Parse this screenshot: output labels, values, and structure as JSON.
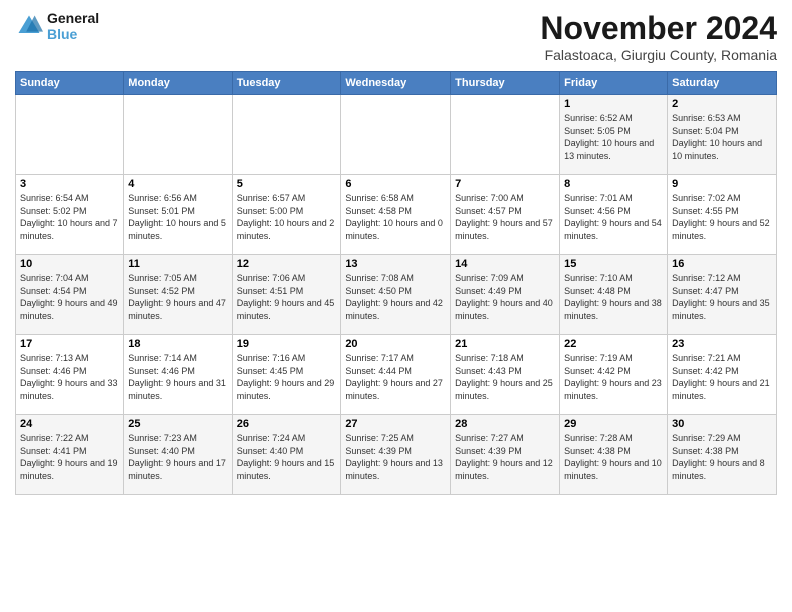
{
  "logo": {
    "line1": "General",
    "line2": "Blue"
  },
  "header": {
    "month_title": "November 2024",
    "subtitle": "Falastoaca, Giurgiu County, Romania"
  },
  "days_of_week": [
    "Sunday",
    "Monday",
    "Tuesday",
    "Wednesday",
    "Thursday",
    "Friday",
    "Saturday"
  ],
  "weeks": [
    [
      {
        "day": "",
        "info": ""
      },
      {
        "day": "",
        "info": ""
      },
      {
        "day": "",
        "info": ""
      },
      {
        "day": "",
        "info": ""
      },
      {
        "day": "",
        "info": ""
      },
      {
        "day": "1",
        "info": "Sunrise: 6:52 AM\nSunset: 5:05 PM\nDaylight: 10 hours and 13 minutes."
      },
      {
        "day": "2",
        "info": "Sunrise: 6:53 AM\nSunset: 5:04 PM\nDaylight: 10 hours and 10 minutes."
      }
    ],
    [
      {
        "day": "3",
        "info": "Sunrise: 6:54 AM\nSunset: 5:02 PM\nDaylight: 10 hours and 7 minutes."
      },
      {
        "day": "4",
        "info": "Sunrise: 6:56 AM\nSunset: 5:01 PM\nDaylight: 10 hours and 5 minutes."
      },
      {
        "day": "5",
        "info": "Sunrise: 6:57 AM\nSunset: 5:00 PM\nDaylight: 10 hours and 2 minutes."
      },
      {
        "day": "6",
        "info": "Sunrise: 6:58 AM\nSunset: 4:58 PM\nDaylight: 10 hours and 0 minutes."
      },
      {
        "day": "7",
        "info": "Sunrise: 7:00 AM\nSunset: 4:57 PM\nDaylight: 9 hours and 57 minutes."
      },
      {
        "day": "8",
        "info": "Sunrise: 7:01 AM\nSunset: 4:56 PM\nDaylight: 9 hours and 54 minutes."
      },
      {
        "day": "9",
        "info": "Sunrise: 7:02 AM\nSunset: 4:55 PM\nDaylight: 9 hours and 52 minutes."
      }
    ],
    [
      {
        "day": "10",
        "info": "Sunrise: 7:04 AM\nSunset: 4:54 PM\nDaylight: 9 hours and 49 minutes."
      },
      {
        "day": "11",
        "info": "Sunrise: 7:05 AM\nSunset: 4:52 PM\nDaylight: 9 hours and 47 minutes."
      },
      {
        "day": "12",
        "info": "Sunrise: 7:06 AM\nSunset: 4:51 PM\nDaylight: 9 hours and 45 minutes."
      },
      {
        "day": "13",
        "info": "Sunrise: 7:08 AM\nSunset: 4:50 PM\nDaylight: 9 hours and 42 minutes."
      },
      {
        "day": "14",
        "info": "Sunrise: 7:09 AM\nSunset: 4:49 PM\nDaylight: 9 hours and 40 minutes."
      },
      {
        "day": "15",
        "info": "Sunrise: 7:10 AM\nSunset: 4:48 PM\nDaylight: 9 hours and 38 minutes."
      },
      {
        "day": "16",
        "info": "Sunrise: 7:12 AM\nSunset: 4:47 PM\nDaylight: 9 hours and 35 minutes."
      }
    ],
    [
      {
        "day": "17",
        "info": "Sunrise: 7:13 AM\nSunset: 4:46 PM\nDaylight: 9 hours and 33 minutes."
      },
      {
        "day": "18",
        "info": "Sunrise: 7:14 AM\nSunset: 4:46 PM\nDaylight: 9 hours and 31 minutes."
      },
      {
        "day": "19",
        "info": "Sunrise: 7:16 AM\nSunset: 4:45 PM\nDaylight: 9 hours and 29 minutes."
      },
      {
        "day": "20",
        "info": "Sunrise: 7:17 AM\nSunset: 4:44 PM\nDaylight: 9 hours and 27 minutes."
      },
      {
        "day": "21",
        "info": "Sunrise: 7:18 AM\nSunset: 4:43 PM\nDaylight: 9 hours and 25 minutes."
      },
      {
        "day": "22",
        "info": "Sunrise: 7:19 AM\nSunset: 4:42 PM\nDaylight: 9 hours and 23 minutes."
      },
      {
        "day": "23",
        "info": "Sunrise: 7:21 AM\nSunset: 4:42 PM\nDaylight: 9 hours and 21 minutes."
      }
    ],
    [
      {
        "day": "24",
        "info": "Sunrise: 7:22 AM\nSunset: 4:41 PM\nDaylight: 9 hours and 19 minutes."
      },
      {
        "day": "25",
        "info": "Sunrise: 7:23 AM\nSunset: 4:40 PM\nDaylight: 9 hours and 17 minutes."
      },
      {
        "day": "26",
        "info": "Sunrise: 7:24 AM\nSunset: 4:40 PM\nDaylight: 9 hours and 15 minutes."
      },
      {
        "day": "27",
        "info": "Sunrise: 7:25 AM\nSunset: 4:39 PM\nDaylight: 9 hours and 13 minutes."
      },
      {
        "day": "28",
        "info": "Sunrise: 7:27 AM\nSunset: 4:39 PM\nDaylight: 9 hours and 12 minutes."
      },
      {
        "day": "29",
        "info": "Sunrise: 7:28 AM\nSunset: 4:38 PM\nDaylight: 9 hours and 10 minutes."
      },
      {
        "day": "30",
        "info": "Sunrise: 7:29 AM\nSunset: 4:38 PM\nDaylight: 9 hours and 8 minutes."
      }
    ]
  ]
}
